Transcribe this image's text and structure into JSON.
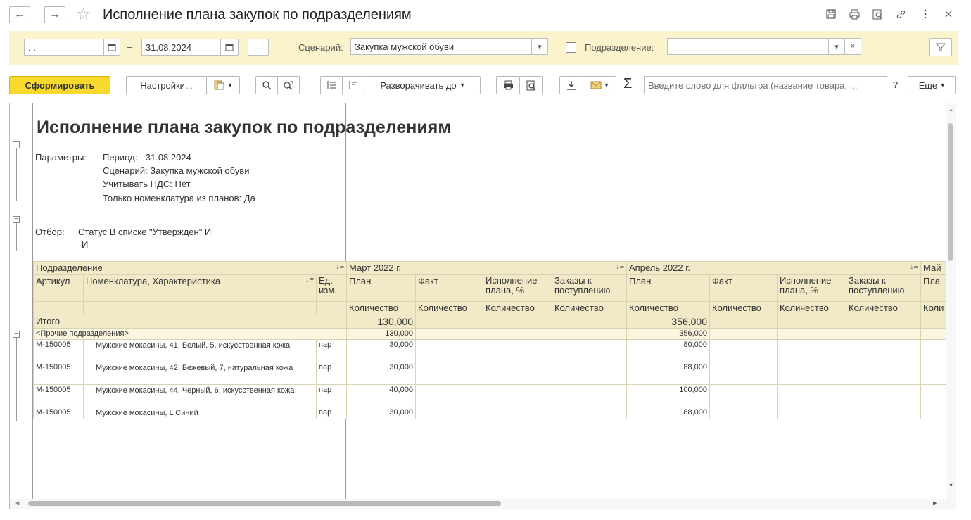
{
  "window": {
    "title": "Исполнение плана закупок по подразделениям",
    "back_icon": "←",
    "forward_icon": "→",
    "star_icon": "☆",
    "icons": [
      "save-icon",
      "print-icon",
      "preview-icon",
      "link-icon",
      "more-icon",
      "close-icon"
    ]
  },
  "filter": {
    "date_from": ". .",
    "dash": "–",
    "date_to": "31.08.2024",
    "ellipsis": "...",
    "scenario_label": "Сценарий:",
    "scenario_value": "Закупка мужской обуви",
    "department_label": "Подразделение:",
    "department_value": "",
    "clear": "×"
  },
  "toolbar": {
    "generate": "Сформировать",
    "settings": "Настройки...",
    "expand_to": "Разворачивать до",
    "filter_placeholder": "Введите слово для фильтра (название товара, ...",
    "help": "?",
    "more": "Еще",
    "sigma": "Σ"
  },
  "report": {
    "title": "Исполнение плана закупок по подразделениям",
    "params_label": "Параметры:",
    "params": [
      "Период:  - 31.08.2024",
      "Сценарий: Закупка мужской обуви",
      "Учитывать НДС: Нет",
      "Только номенклатура из планов: Да"
    ],
    "filter_label": "Отбор:",
    "filter_lines": [
      "Статус В списке \"Утвержден\" И",
      "И"
    ],
    "headers": {
      "department": "Подразделение",
      "article": "Артикул",
      "nomenclature": "Номенклатура, Характеристика",
      "unit": "Ед. изм.",
      "month1": "Март 2022 г.",
      "month2": "Апрель 2022 г.",
      "month3": "Май",
      "plan": "План",
      "fact": "Факт",
      "execution": "Исполнение плана, %",
      "orders": "Заказы к поступлению",
      "quantity": "Количество",
      "quantity_cut": "Коли",
      "plan_cut": "Пла"
    },
    "total": {
      "label": "Итого",
      "mar_plan": "130,000",
      "apr_plan": "356,000"
    },
    "group": {
      "label": "<Прочие подразделения>",
      "mar_plan": "130,000",
      "apr_plan": "356,000"
    },
    "rows": [
      {
        "article": "М-150005",
        "name": "Мужские мокасины, 41, Белый, 5, искусственная кожа",
        "unit": "пар",
        "mar_plan": "30,000",
        "apr_plan": "80,000"
      },
      {
        "article": "М-150005",
        "name": "Мужские мокасины, 42, Бежевый, 7, натуральная кожа",
        "unit": "пар",
        "mar_plan": "30,000",
        "apr_plan": "88,000"
      },
      {
        "article": "М-150005",
        "name": "Мужские мокасины, 44, Черный, 6, искусственная кожа",
        "unit": "пар",
        "mar_plan": "40,000",
        "apr_plan": "100,000"
      },
      {
        "article": "М-150005",
        "name": "Мужские мокасины, L Синий",
        "unit": "пар",
        "mar_plan": "30,000",
        "apr_plan": "88,000"
      }
    ]
  }
}
